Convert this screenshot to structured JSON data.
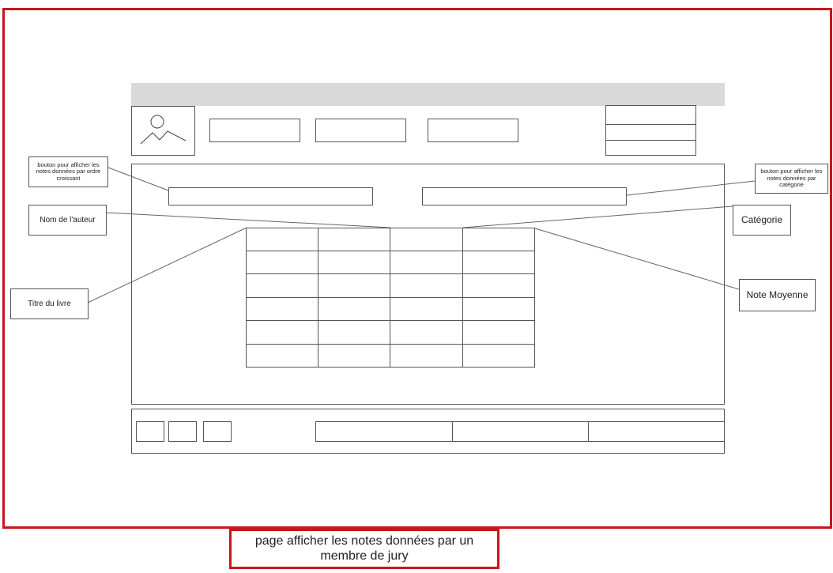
{
  "annotations": {
    "sort_ascending": "bouton pour afficher les notes données par ordre croissant",
    "by_category": "bouton pour afficher les notes données par catégorie",
    "author_name": "Nom de l'auteur",
    "category": "Catégorie",
    "book_title": "Titre du livre",
    "average_grade": "Note Moyenne"
  },
  "caption": "page afficher les notes données par un membre de jury",
  "colors": {
    "frame": "#c8161d",
    "header_bar": "#d9d9d9",
    "lines": "#555555"
  },
  "icons": {
    "logo": "image-placeholder-icon"
  }
}
